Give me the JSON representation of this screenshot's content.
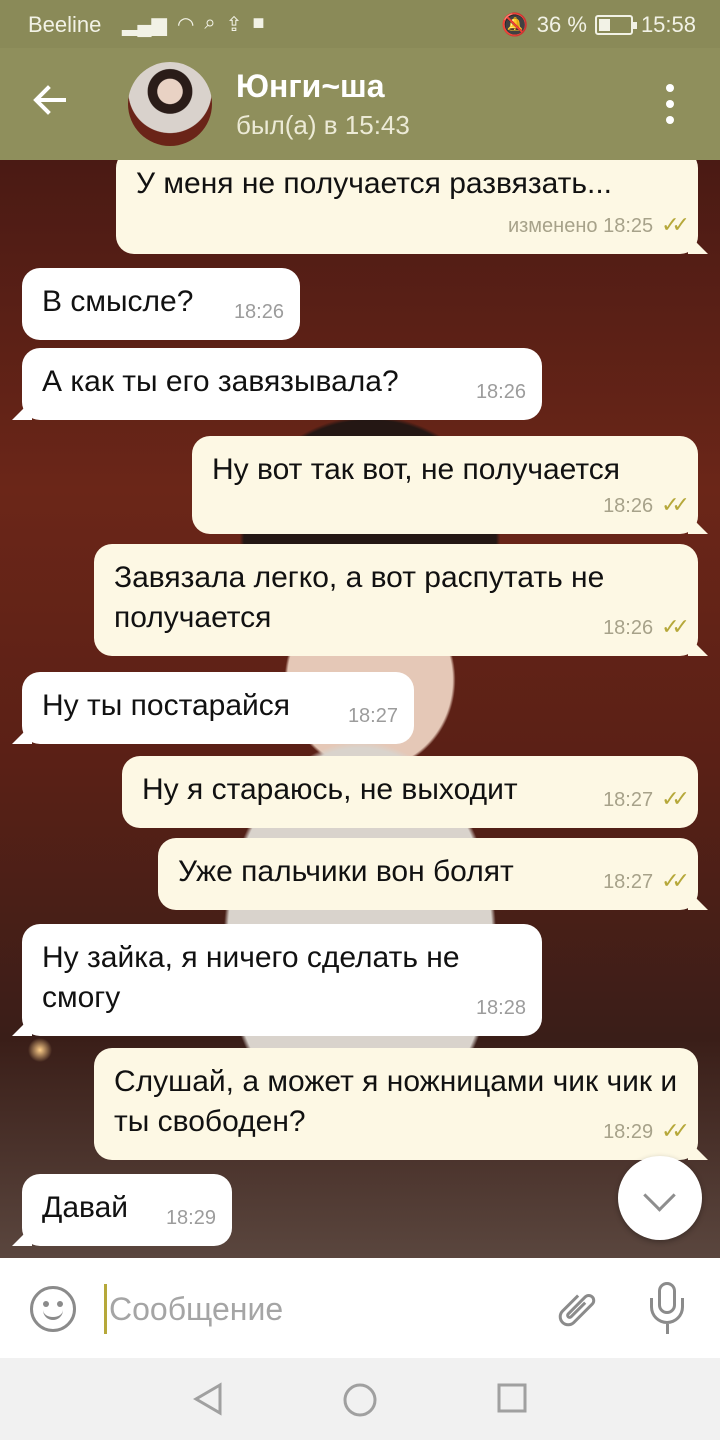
{
  "status_bar": {
    "carrier": "Beeline",
    "battery_percent": "36 %",
    "battery_level": 0.36,
    "time": "15:58"
  },
  "header": {
    "contact_name": "Юнги~ша",
    "last_seen": "был(а) в 15:43"
  },
  "messages": [
    {
      "direction": "out",
      "text": "У меня не получается развязать...",
      "time": "изменено 18:25",
      "read": true
    },
    {
      "direction": "in",
      "text": "В смысле?",
      "time": "18:26"
    },
    {
      "direction": "in",
      "text": "А как ты его завязывала?",
      "time": "18:26"
    },
    {
      "direction": "out",
      "text": "Ну вот так вот, не получается",
      "time": "18:26",
      "read": true
    },
    {
      "direction": "out",
      "text": "Завязала легко, а вот распутать не получается",
      "time": "18:26",
      "read": true
    },
    {
      "direction": "in",
      "text": "Ну ты постарайся",
      "time": "18:27"
    },
    {
      "direction": "out",
      "text": "Ну я стараюсь, не выходит",
      "time": "18:27",
      "read": true
    },
    {
      "direction": "out",
      "text": "Уже пальчики вон болят",
      "time": "18:27",
      "read": true
    },
    {
      "direction": "in",
      "text": "Ну зайка, я ничего сделать не смогу",
      "time": "18:28"
    },
    {
      "direction": "out",
      "text": "Слушай, а может я ножницами чик чик и ты свободен?",
      "time": "18:29",
      "read": true
    },
    {
      "direction": "in",
      "text": "Давай",
      "time": "18:29"
    }
  ],
  "composer": {
    "placeholder": "Сообщение"
  },
  "colors": {
    "header_bg": "#8f8f5c",
    "outgoing_bubble": "#fdf8e4",
    "incoming_bubble": "#ffffff",
    "read_check": "#b6a83a"
  }
}
